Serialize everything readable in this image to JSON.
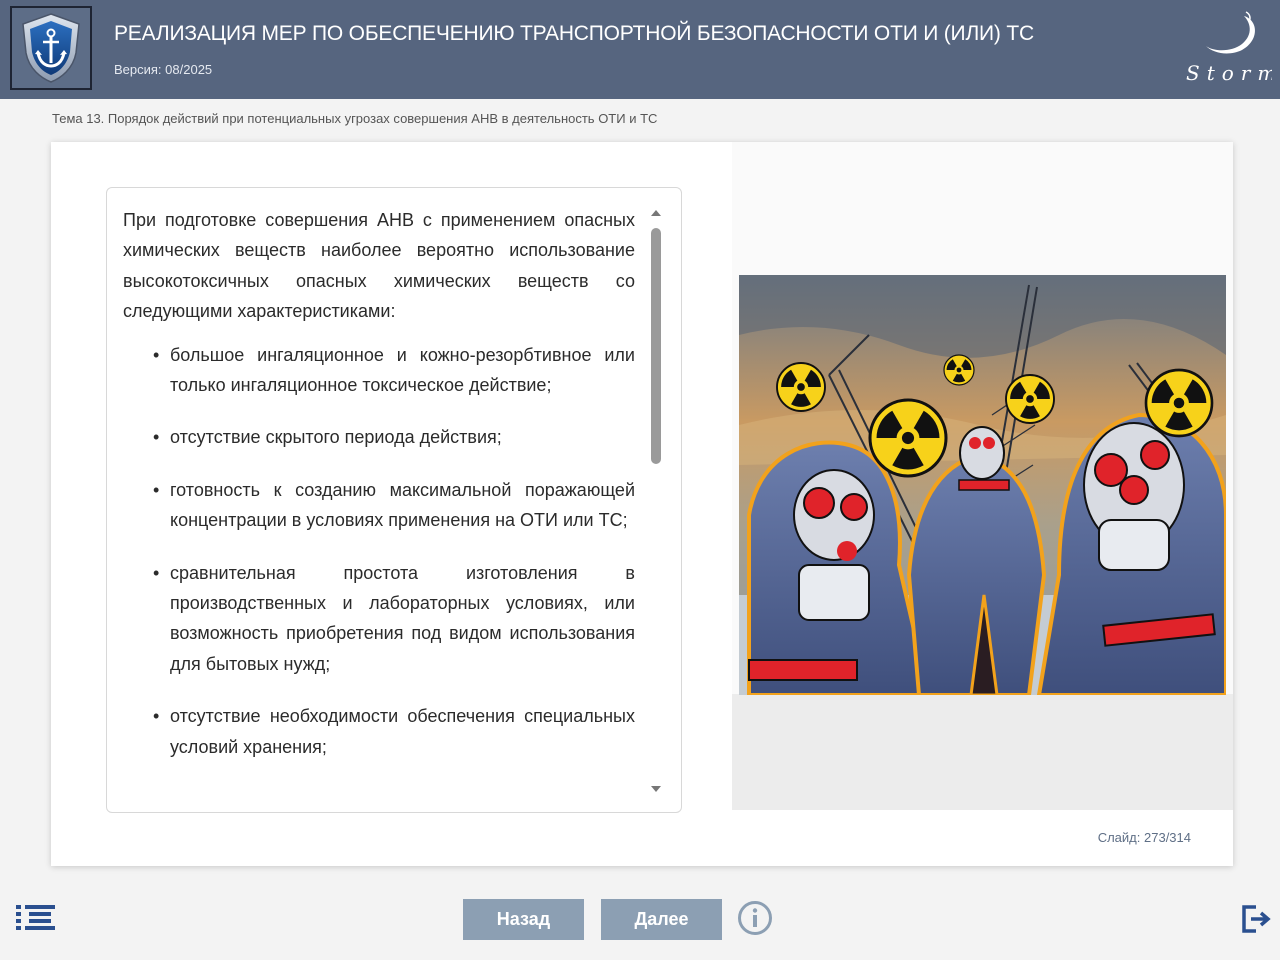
{
  "header": {
    "title": "РЕАЛИЗАЦИЯ МЕР ПО ОБЕСПЕЧЕНИЮ ТРАНСПОРТНОЙ БЕЗОПАСНОСТИ ОТИ И (ИЛИ) ТС",
    "version": "Версия: 08/2025",
    "logo_icon": "anchor-shield-icon",
    "brand": "Storm"
  },
  "topic": "Тема 13. Порядок действий при потенциальных угрозах совершения АНВ в деятельность ОТИ и ТС",
  "content": {
    "intro": "При подготовке совершения АНВ с применением опасных химических веществ наиболее вероятно использование высокотоксичных опасных химических веществ со следующими характеристиками:",
    "items": [
      "большое ингаляционное и кожно-резорбтивное или только ингаляционное токсическое действие;",
      "отсутствие скрытого периода действия;",
      "готовность к созданию максимальной поражающей концентрации в условиях применения на ОТИ или ТС;",
      "сравнительная простота изготовления в производственных и лабораторных условиях, или возможность приобретения под видом использования для бытовых нужд;",
      "отсутствие необходимости обеспечения специальных условий хранения;"
    ],
    "scroll_position": 0.0
  },
  "slide": {
    "label": "Слайд:",
    "value": "273/314"
  },
  "nav": {
    "back_label": "Назад",
    "next_label": "Далее",
    "menu_icon": "menu-list-icon",
    "info_icon": "info-icon",
    "exit_icon": "exit-icon"
  },
  "colors": {
    "header_bg": "#56657f",
    "button_bg": "#8c9fb3",
    "accent_yellow": "#f5d000",
    "accent_red": "#e02020"
  }
}
